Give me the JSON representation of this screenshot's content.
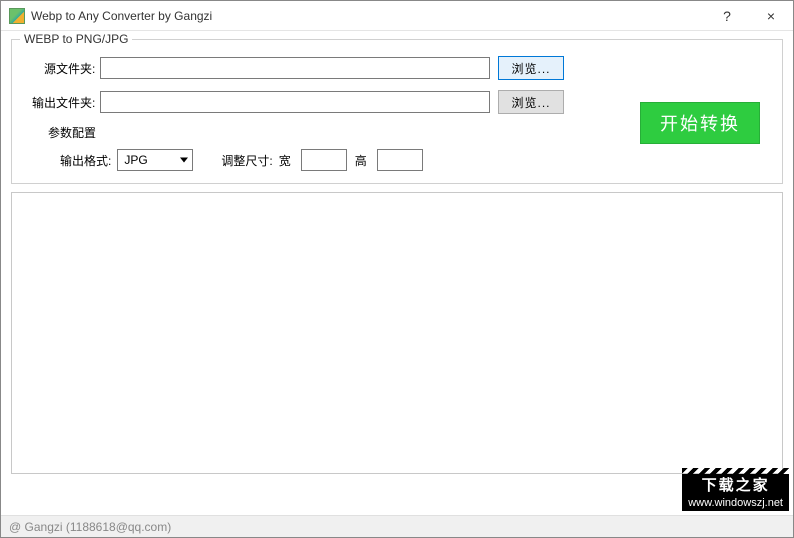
{
  "window": {
    "title": "Webp to Any Converter by Gangzi",
    "help_icon": "?",
    "close_icon": "×"
  },
  "group": {
    "legend": "WEBP to PNG/JPG",
    "source_label": "源文件夹:",
    "output_label": "输出文件夹:",
    "browse_label": "浏览...",
    "start_label": "开始转换",
    "params_label": "参数配置",
    "format_label": "输出格式:",
    "format_value": "JPG",
    "resize_label": "调整尺寸:",
    "width_label": "宽",
    "height_label": "高",
    "source_value": "",
    "output_value": "",
    "width_value": "",
    "height_value": ""
  },
  "status": {
    "text": "@ Gangzi (1188618@qq.com)"
  },
  "watermark": {
    "line1": "下载之家",
    "line2": "www.windowszj.net"
  }
}
